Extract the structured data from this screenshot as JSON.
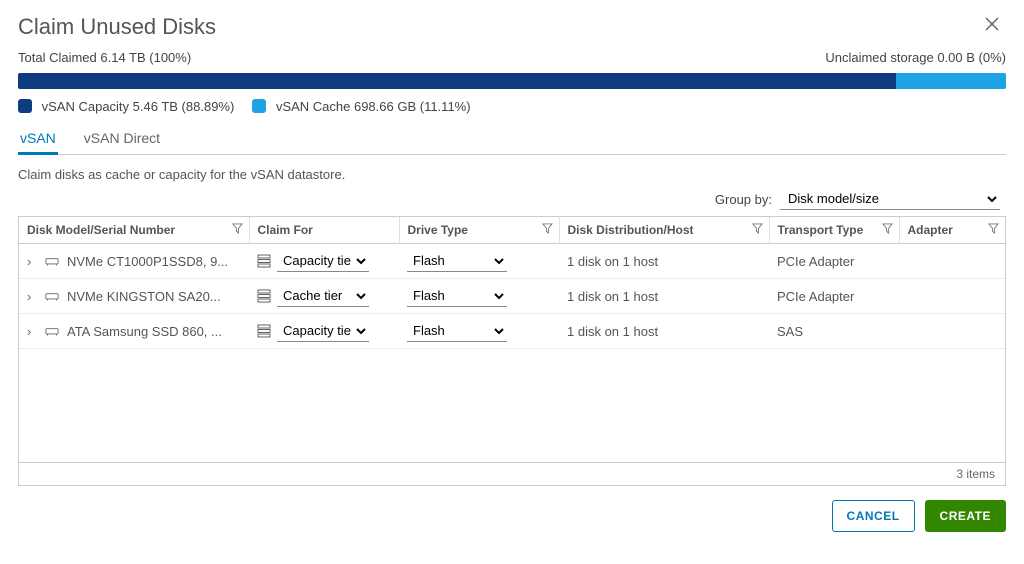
{
  "dialog": {
    "title": "Claim Unused Disks"
  },
  "summary": {
    "claimed_label": "Total Claimed 6.14 TB (100%)",
    "unclaimed_label": "Unclaimed storage 0.00 B (0%)",
    "capacity_pct": 88.89,
    "cache_pct": 11.11
  },
  "legend": {
    "capacity": "vSAN Capacity 5.46 TB (88.89%)",
    "cache": "vSAN Cache 698.66 GB (11.11%)"
  },
  "tabs": {
    "vsan": "vSAN",
    "vsan_direct": "vSAN Direct",
    "active": "vsan"
  },
  "subtext": "Claim disks as cache or capacity for the vSAN datastore.",
  "groupby": {
    "label": "Group by:",
    "selected": "Disk model/size"
  },
  "columns": {
    "model": "Disk Model/Serial Number",
    "claim": "Claim For",
    "drive": "Drive Type",
    "dist": "Disk Distribution/Host",
    "transport": "Transport Type",
    "adapter": "Adapter"
  },
  "rows": [
    {
      "model": "NVMe CT1000P1SSD8, 9...",
      "claim": "Capacity tier",
      "drive": "Flash",
      "dist": "1 disk on 1 host",
      "transport": "PCIe Adapter",
      "adapter": ""
    },
    {
      "model": "NVMe KINGSTON SA20...",
      "claim": "Cache tier",
      "drive": "Flash",
      "dist": "1 disk on 1 host",
      "transport": "PCIe Adapter",
      "adapter": ""
    },
    {
      "model": "ATA Samsung SSD 860, ...",
      "claim": "Capacity tier",
      "drive": "Flash",
      "dist": "1 disk on 1 host",
      "transport": "SAS",
      "adapter": ""
    }
  ],
  "footer": {
    "count_label": "3 items"
  },
  "actions": {
    "cancel": "CANCEL",
    "create": "CREATE"
  }
}
